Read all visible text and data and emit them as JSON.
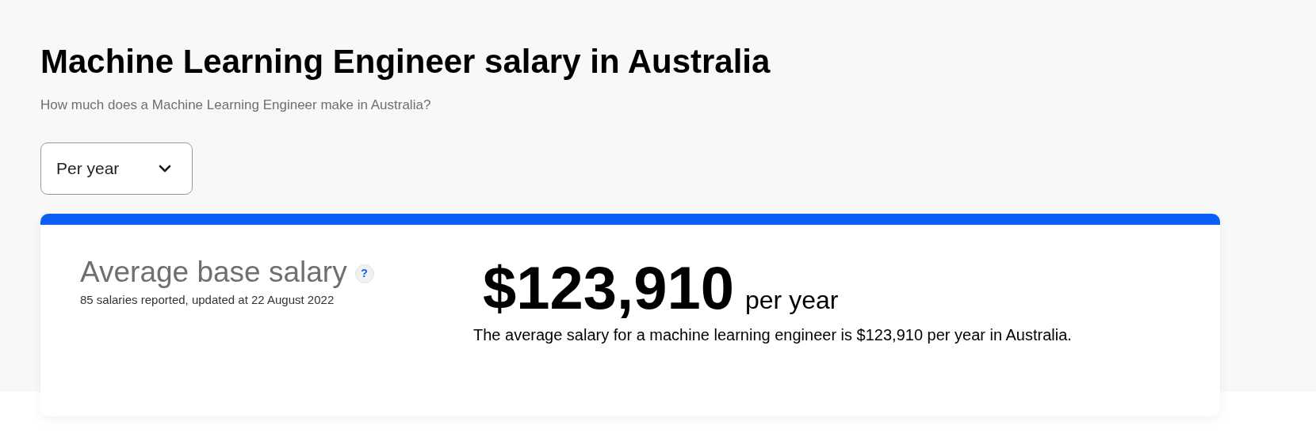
{
  "title": "Machine Learning Engineer salary in Australia",
  "subtitle": "How much does a Machine Learning Engineer make in Australia?",
  "period_select": {
    "value": "Per year"
  },
  "salary_card": {
    "heading": "Average base salary",
    "help_icon": "?",
    "note": "85 salaries reported, updated at 22 August 2022",
    "amount": "$123,910",
    "period": "per year",
    "summary": "The average salary for a machine learning engineer is $123,910 per year in Australia."
  }
}
